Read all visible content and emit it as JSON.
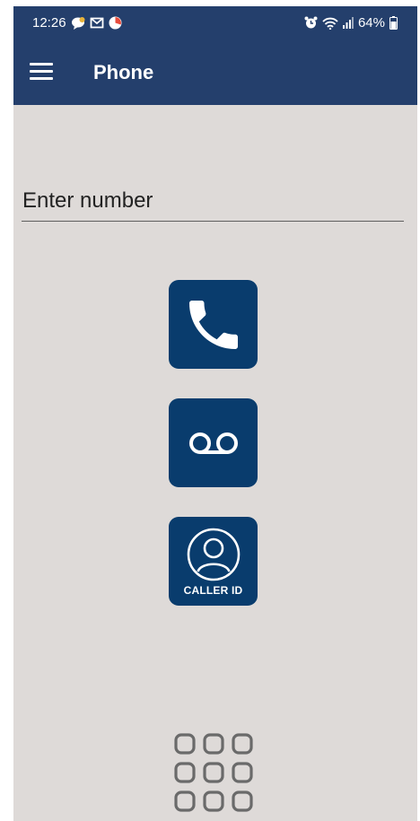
{
  "status_bar": {
    "time": "12:26",
    "battery": "64%",
    "left_icons": [
      "chat-bubble-icon",
      "gmail-icon",
      "clock-app-icon"
    ],
    "right_icons": [
      "alarm-icon",
      "wifi-icon",
      "signal-icon",
      "battery-icon"
    ]
  },
  "app_bar": {
    "title": "Phone",
    "menu_icon": "hamburger-menu-icon"
  },
  "dialer": {
    "placeholder": "Enter number",
    "value": ""
  },
  "actions": {
    "call_icon": "phone-handset-icon",
    "voicemail_icon": "voicemail-icon",
    "caller_id_label": "CALLER ID",
    "caller_id_icon": "person-icon",
    "keypad_icon": "keypad-icon"
  },
  "colors": {
    "header": "#243f6c",
    "tile": "#093c6d",
    "background": "#dedad8"
  }
}
